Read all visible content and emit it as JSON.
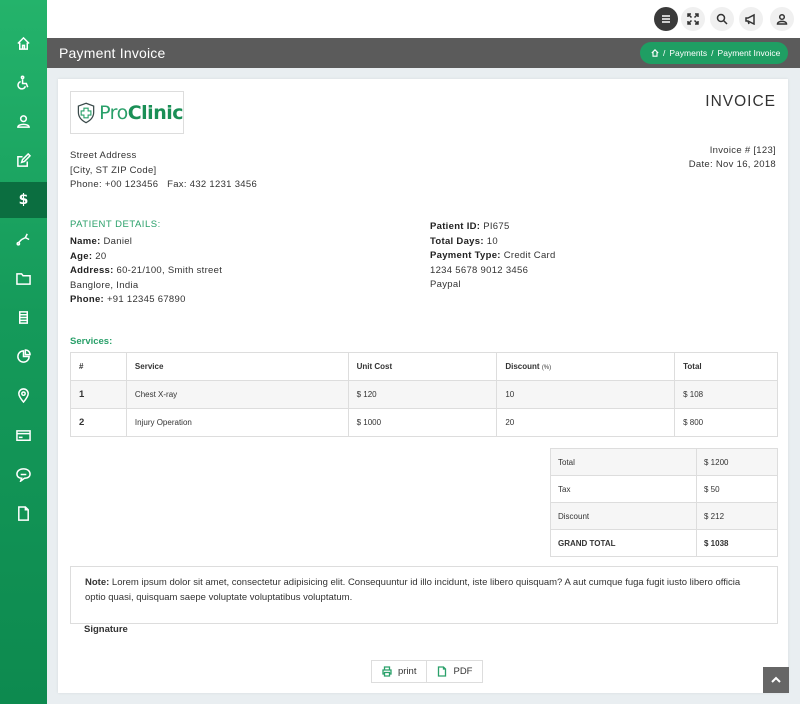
{
  "sidebar": {
    "items": [
      {
        "icon": "home-icon"
      },
      {
        "icon": "accessible-icon"
      },
      {
        "icon": "user-icon"
      },
      {
        "icon": "edit-icon"
      },
      {
        "icon": "dollar-icon",
        "glyph": "$",
        "active": true
      },
      {
        "icon": "stethoscope-icon"
      },
      {
        "icon": "folder-icon"
      },
      {
        "icon": "list-icon"
      },
      {
        "icon": "pie-chart-icon"
      },
      {
        "icon": "location-icon"
      },
      {
        "icon": "card-icon"
      },
      {
        "icon": "chat-icon"
      },
      {
        "icon": "file-icon"
      }
    ]
  },
  "topbar": {
    "buttons": [
      "menu-icon",
      "fullscreen-icon",
      "search-icon",
      "megaphone-icon",
      "user-icon"
    ]
  },
  "header": {
    "title": "Payment Invoice",
    "breadcrumb": {
      "sep": "/",
      "items": [
        "Payments",
        "Payment Invoice"
      ]
    }
  },
  "invoice": {
    "logo": {
      "pro": "Pro",
      "clinic": "Clinic"
    },
    "heading": "INVOICE",
    "number": "Invoice # [123]",
    "date": "Date: Nov 16, 2018",
    "address": {
      "street": "Street Address",
      "city": "[City, ST ZIP Code]",
      "phone": "Phone: +00 123456   Fax: 432 1231 3456"
    },
    "patient_header": "PATIENT DETAILS:",
    "patient": {
      "name_label": "Name:",
      "name": " Daniel",
      "age_label": "Age:",
      "age": " 20",
      "address_label": "Address:",
      "address1": " 60-21/100, Smith street",
      "address2": "Banglore, India",
      "phone_label": "Phone:",
      "phone": " +91 12345 67890"
    },
    "payment": {
      "id_label": "Patient ID:",
      "id": " PI675",
      "days_label": "Total Days:",
      "days": " 10",
      "type_label": "Payment Type:",
      "type": " Credit Card",
      "card": "1234 5678 9012 3456",
      "alt": "Paypal"
    },
    "services_header": "Services:",
    "services_columns": {
      "num": "#",
      "service": "Service",
      "unit": "Unit Cost",
      "discount": "Discount",
      "discount_unit": "(%)",
      "total": "Total"
    },
    "services": [
      {
        "num": "1",
        "service": "Chest X-ray",
        "unit": "$ 120",
        "discount": "10",
        "total": "$ 108"
      },
      {
        "num": "2",
        "service": "Injury Operation",
        "unit": "$ 1000",
        "discount": "20",
        "total": "$ 800"
      }
    ],
    "totals": [
      {
        "label": "Total",
        "value": "$ 1200"
      },
      {
        "label": "Tax",
        "value": "$ 50"
      },
      {
        "label": "Discount",
        "value": "$ 212"
      },
      {
        "label": "GRAND TOTAL",
        "value": "$ 1038"
      }
    ],
    "note_label": "Note:",
    "note": " Lorem ipsum dolor sit amet, consectetur adipisicing elit. Consequuntur id illo incidunt, iste libero quisquam? A aut cumque fuga fugit iusto libero officia optio quasi, quisquam saepe voluptate voluptatibus voluptatum.",
    "signature": "Signature",
    "print_label": "print",
    "pdf_label": "PDF"
  },
  "colors": {
    "accent": "#2aa06a",
    "sidebar": "#159a5a",
    "titlebar": "#5b5b5b"
  }
}
